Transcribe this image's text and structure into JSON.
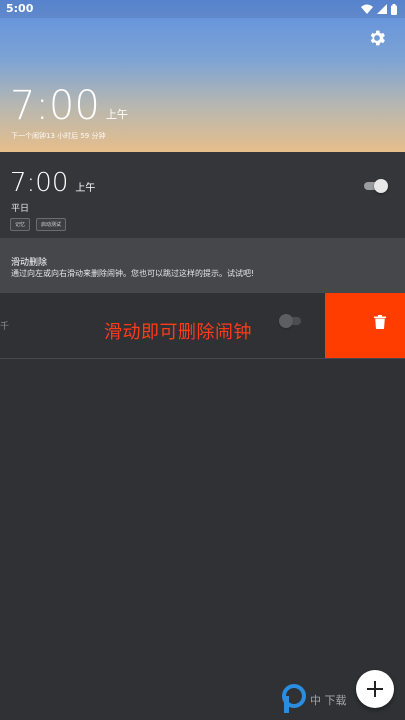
{
  "status_bar": {
    "time": "5:00"
  },
  "header": {
    "time": "7:00",
    "ampm": "上午",
    "next_alarm": "下一个闹钟13 小时后 59 分钟"
  },
  "alarm": {
    "time": "7:00",
    "ampm": "上午",
    "repeat": "平日",
    "tags": [
      "记忆",
      "启动测试"
    ],
    "enabled": true
  },
  "hint": {
    "title": "滑动删除",
    "text": "通过向左或向右滑动来删除闹钟。您也可以跳过这样的提示。试试吧!"
  },
  "swipe_row": {
    "ghost_text": "千"
  },
  "overlay_caption": "滑动即可删除闹钟",
  "watermark": {
    "text": "中  下载"
  },
  "colors": {
    "accent": "#ff3d00",
    "background": "#2f3134",
    "caption": "#ff3b1a"
  }
}
